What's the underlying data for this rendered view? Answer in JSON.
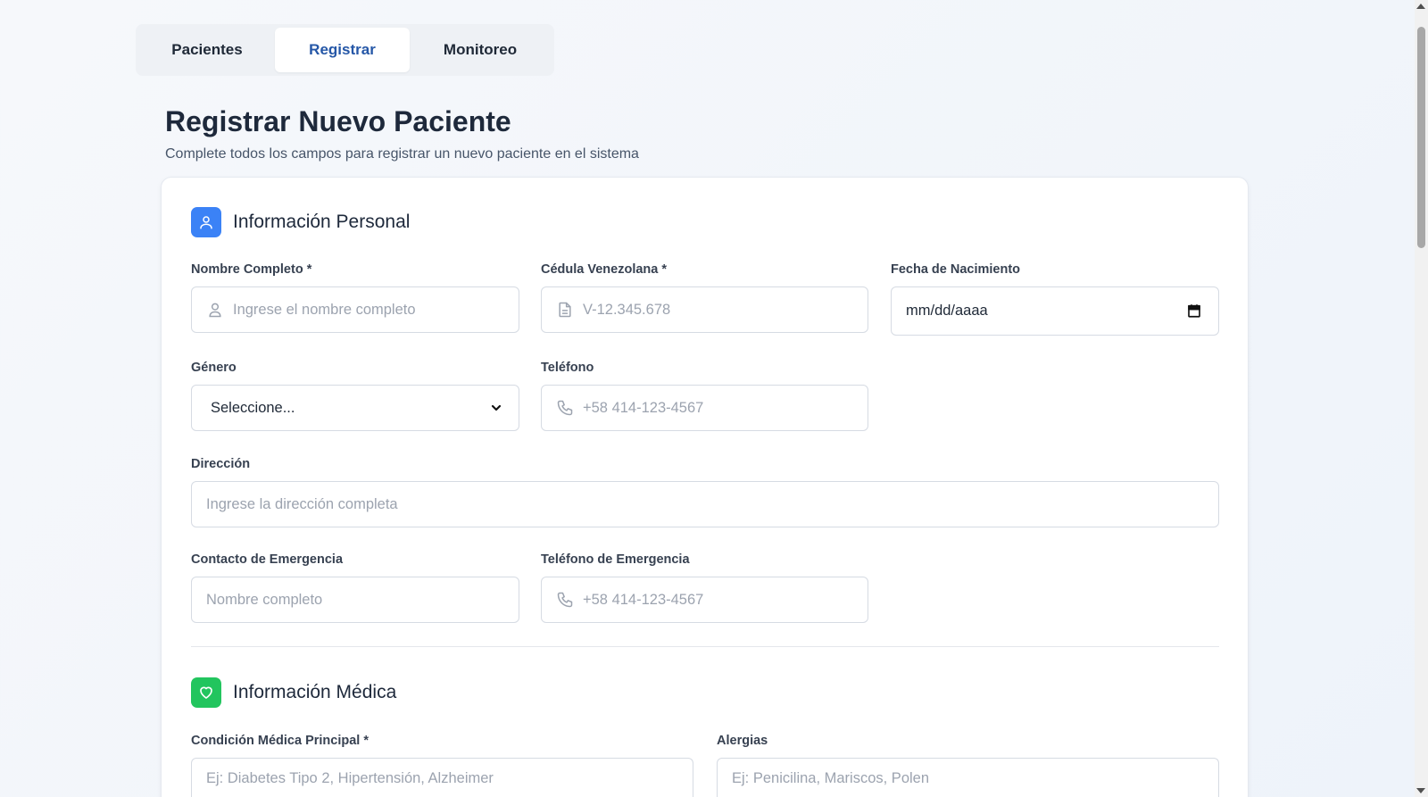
{
  "tabs": [
    {
      "label": "Pacientes",
      "active": false
    },
    {
      "label": "Registrar",
      "active": true
    },
    {
      "label": "Monitoreo",
      "active": false
    }
  ],
  "header": {
    "title": "Registrar Nuevo Paciente",
    "subtitle": "Complete todos los campos para registrar un nuevo paciente en el sistema"
  },
  "personal": {
    "title": "Información Personal",
    "icon": "user-icon",
    "nombre": {
      "label": "Nombre Completo *",
      "placeholder": "Ingrese el nombre completo",
      "icon": "user-icon"
    },
    "cedula": {
      "label": "Cédula Venezolana *",
      "placeholder": "V-12.345.678",
      "icon": "document-icon"
    },
    "fecha": {
      "label": "Fecha de Nacimiento",
      "value": "mm/dd/aaaa",
      "icon": "calendar-icon"
    },
    "genero": {
      "label": "Género",
      "value": "Seleccione...",
      "icon": "chevron-down-icon"
    },
    "telefono": {
      "label": "Teléfono",
      "placeholder": "+58 414-123-4567",
      "icon": "phone-icon"
    },
    "direccion": {
      "label": "Dirección",
      "placeholder": "Ingrese la dirección completa"
    },
    "contacto": {
      "label": "Contacto de Emergencia",
      "placeholder": "Nombre completo"
    },
    "telefono_emergencia": {
      "label": "Teléfono de Emergencia",
      "placeholder": "+58 414-123-4567",
      "icon": "phone-icon"
    }
  },
  "medical": {
    "title": "Información Médica",
    "icon": "heart-icon",
    "condicion": {
      "label": "Condición Médica Principal *",
      "placeholder": "Ej: Diabetes Tipo 2, Hipertensión, Alzheimer"
    },
    "alergias": {
      "label": "Alergias",
      "placeholder": "Ej: Penicilina, Mariscos, Polen"
    }
  },
  "colors": {
    "accent": "#2557a7",
    "blue_icon": "#3b82f6",
    "green_icon": "#22c55e"
  }
}
